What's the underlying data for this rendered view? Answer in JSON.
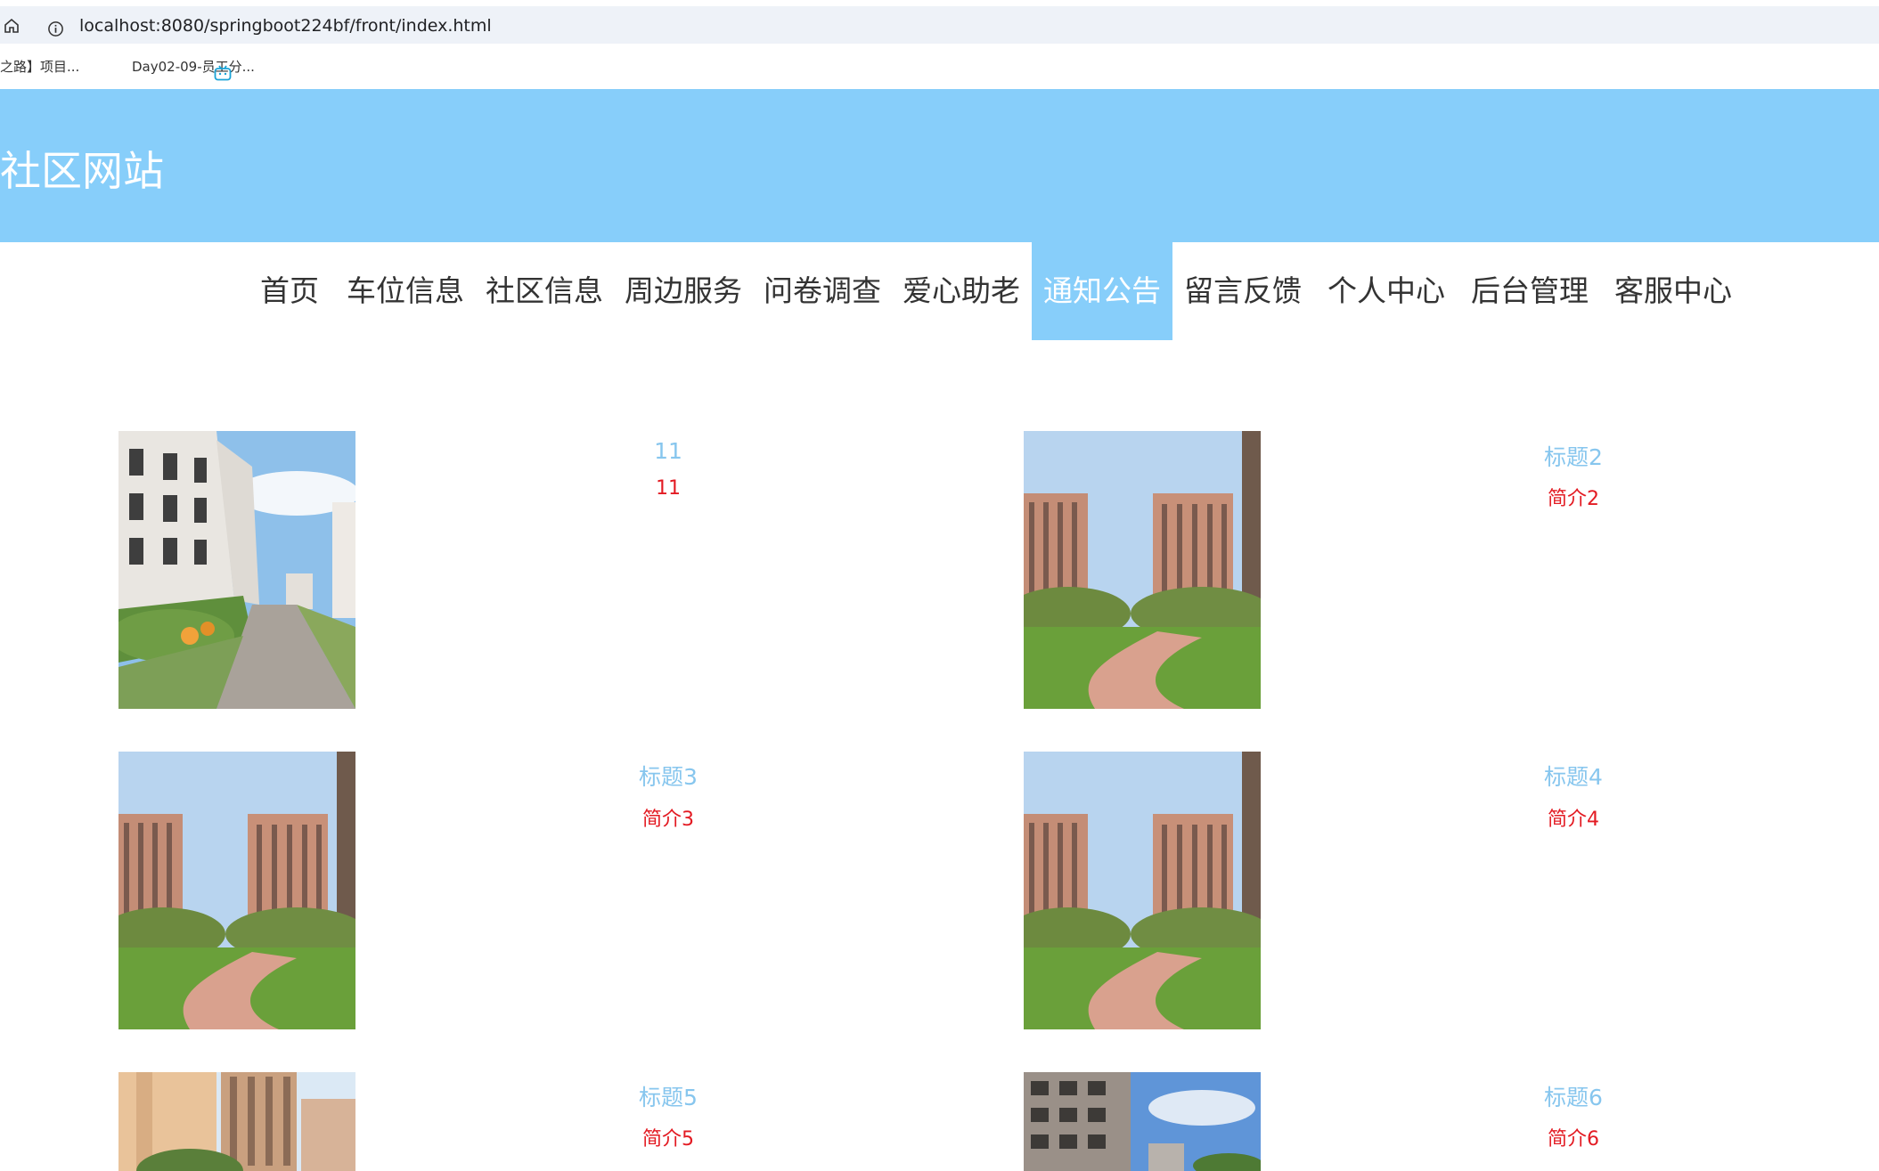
{
  "browser": {
    "url": "localhost:8080/springboot224bf/front/index.html",
    "bookmarks": [
      "之路】项目...",
      "Day02-09-员工分..."
    ]
  },
  "site": {
    "title": "社区网站"
  },
  "nav": {
    "items": [
      "首页",
      "车位信息",
      "社区信息",
      "周边服务",
      "问卷调查",
      "爱心助老",
      "通知公告",
      "留言反馈",
      "个人中心",
      "后台管理",
      "客服中心"
    ],
    "active_index": 6,
    "active_color": "#87cefa"
  },
  "cards": [
    {
      "title": "11",
      "desc": "11",
      "image": "street-building"
    },
    {
      "title": "标题2",
      "desc": "简介2",
      "image": "towers-park"
    },
    {
      "title": "标题3",
      "desc": "简介3",
      "image": "towers-park"
    },
    {
      "title": "标题4",
      "desc": "简介4",
      "image": "towers-park"
    },
    {
      "title": "标题5",
      "desc": "简介5",
      "image": "highrise-tan"
    },
    {
      "title": "标题6",
      "desc": "简介6",
      "image": "old-apartment"
    }
  ],
  "colors": {
    "header": "#87cefa",
    "title_text": "#87c6ee",
    "desc_text": "#e31b23"
  }
}
